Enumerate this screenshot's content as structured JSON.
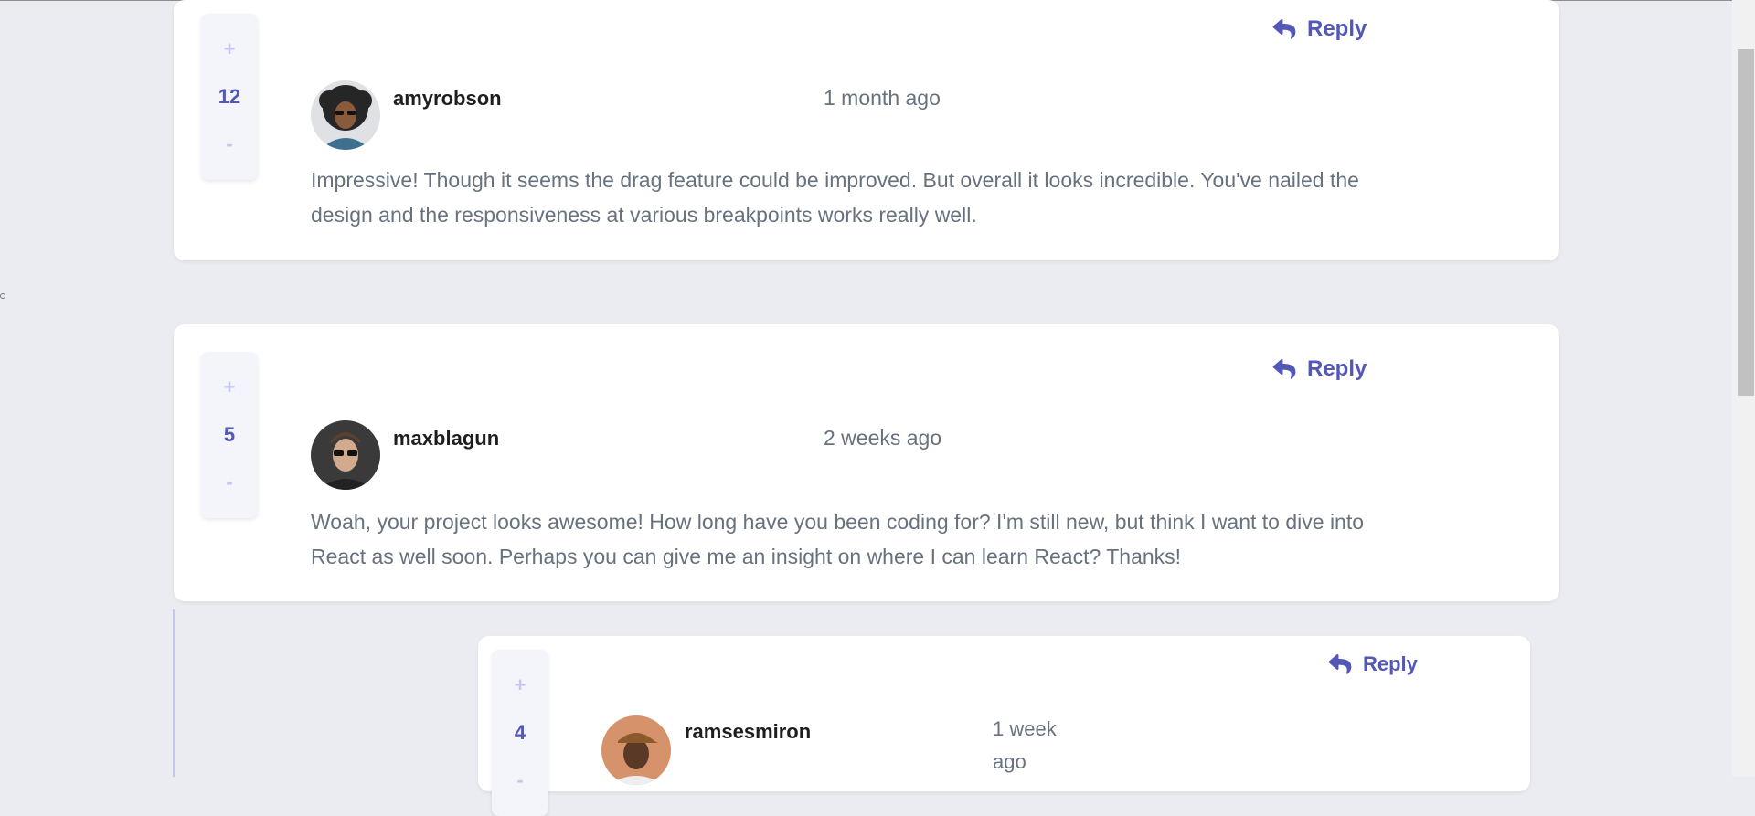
{
  "reply_label": "Reply",
  "colors": {
    "accent": "#5357b6",
    "vote_light": "#c5c6ef",
    "text": "#67727e",
    "username": "#1e1e1e",
    "background": "#eaecf1"
  },
  "icons": {
    "reply": "reply-arrow-icon",
    "upvote": "plus",
    "downvote": "minus"
  },
  "comments": [
    {
      "username": "amyrobson",
      "time": "1 month ago",
      "score": "12",
      "content": "Impressive! Though it seems the drag feature could be improved. But overall it looks incredible. You've nailed the design and the responsiveness at various breakpoints works really well."
    },
    {
      "username": "maxblagun",
      "time": "2 weeks ago",
      "score": "5",
      "content": "Woah, your project looks awesome! How long have you been coding for? I'm still new, but think I want to dive into React as well soon. Perhaps you can give me an insight on where I can learn React? Thanks!"
    }
  ],
  "replies": [
    {
      "username": "ramsesmiron",
      "time": "1 week ago",
      "score": "4"
    }
  ],
  "vote": {
    "plus": "+",
    "minus": "-"
  }
}
